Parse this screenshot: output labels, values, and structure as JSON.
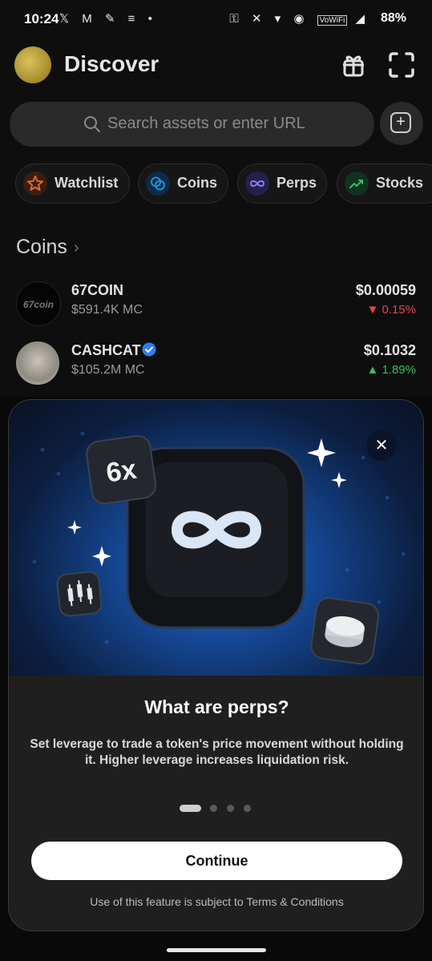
{
  "status_bar": {
    "time": "10:24",
    "left_icons": [
      "x-icon",
      "gmail-icon",
      "pen-icon",
      "app-icon",
      "dot"
    ],
    "right_icons": [
      "key-icon",
      "mute-icon",
      "wifi-icon",
      "hotspot-icon",
      "vowifi-icon",
      "signal-icon"
    ],
    "vowifi": "VoWiFi",
    "battery": "88%"
  },
  "header": {
    "title": "Discover"
  },
  "search": {
    "placeholder": "Search assets or enter URL"
  },
  "chips": [
    {
      "label": "Watchlist",
      "icon": "star-icon",
      "color": "#e3682e"
    },
    {
      "label": "Coins",
      "icon": "coins-icon",
      "color": "#1a8fe0"
    },
    {
      "label": "Perps",
      "icon": "infinity-icon",
      "color": "#8a7cf0"
    },
    {
      "label": "Stocks",
      "icon": "trend-up-icon",
      "color": "#2fbf62"
    }
  ],
  "coins_section": {
    "title": "Coins",
    "items": [
      {
        "name": "67COIN",
        "market_cap": "$591.4K MC",
        "price": "$0.00059",
        "change": "0.15%",
        "direction": "down"
      },
      {
        "name": "CASHCAT",
        "market_cap": "$105.2M MC",
        "price": "$0.1032",
        "change": "1.89%",
        "direction": "up",
        "verified": true
      }
    ]
  },
  "modal": {
    "badge_text": "6x",
    "title": "What are perps?",
    "description": "Set leverage to trade a token's price movement without holding it. Higher leverage increases liquidation risk.",
    "pages": 4,
    "active_page": 1,
    "continue_label": "Continue",
    "terms": "Use of this feature is subject to Terms & Conditions"
  },
  "colors": {
    "up": "#2fbf62",
    "down": "#e0474c",
    "verified": "#2f7ef0"
  }
}
